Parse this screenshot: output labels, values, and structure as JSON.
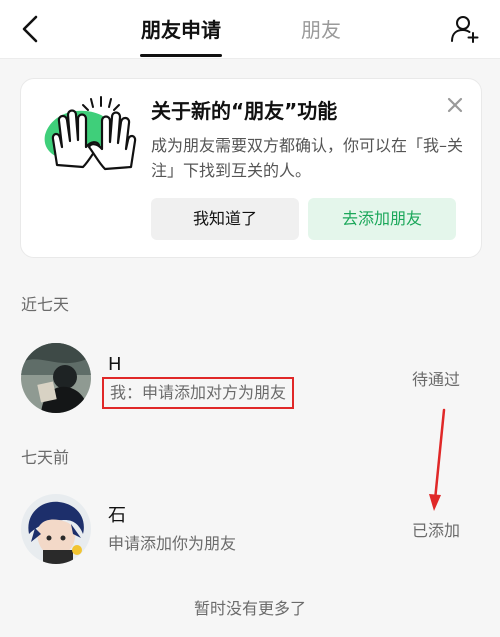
{
  "header": {
    "tabs": [
      {
        "label": "朋友申请",
        "active": true
      },
      {
        "label": "朋友",
        "active": false
      }
    ],
    "back_icon": "chevron-left-icon",
    "add_icon": "add-user-icon"
  },
  "notice": {
    "title": "关于新的“朋友”功能",
    "description": "成为朋友需要双方都确认，你可以在「我–关注」下找到互关的人。",
    "close_icon": "close-icon",
    "illustration_icon": "high-five-hands-icon",
    "buttons": {
      "got_it": "我知道了",
      "add_friend": "去添加朋友"
    },
    "colors": {
      "accent_green": "#1ba75a",
      "accent_bg": "#e4f6eb"
    }
  },
  "sections": {
    "recent": {
      "label": "近七天",
      "items": [
        {
          "name": "H",
          "message": "我：申请添加对方为朋友",
          "status": "待通过"
        }
      ]
    },
    "older": {
      "label": "七天前",
      "items": [
        {
          "name": "石",
          "message": "申请添加你为朋友",
          "status": "已添加"
        }
      ]
    }
  },
  "footer": {
    "note": "暂时没有更多了"
  },
  "annotation": {
    "highlight_color": "#e02828"
  }
}
